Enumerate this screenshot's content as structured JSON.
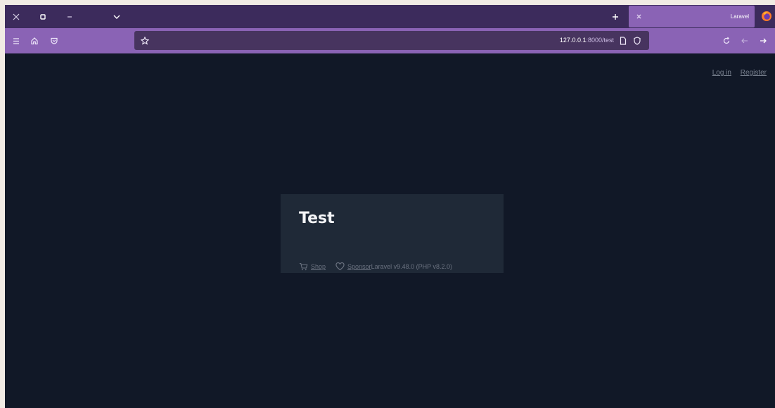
{
  "browser": {
    "tab": {
      "title": "Laravel"
    },
    "url": {
      "host": "127.0.0.1",
      "path": ":8000/test"
    },
    "colors": {
      "tabstrip": "#3c2b5c",
      "accent": "#8a63b5",
      "urlbar": "#47345f"
    }
  },
  "page": {
    "nav": {
      "login": "Log in",
      "register": "Register"
    },
    "card": {
      "title": "Test",
      "shop": "Shop",
      "sponsor": "Sponsor",
      "version": "Laravel v9.48.0 (PHP v8.2.0)"
    }
  }
}
